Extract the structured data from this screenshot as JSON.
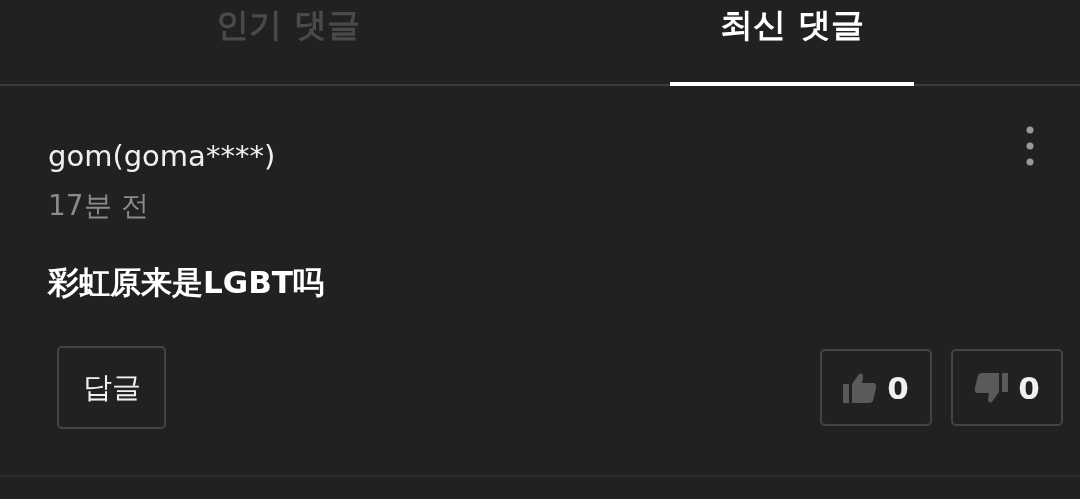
{
  "tabs": [
    {
      "label": "인기 댓글",
      "selected": false
    },
    {
      "label": "최신 댓글",
      "selected": true
    }
  ],
  "comment": {
    "author": "gom(goma****)",
    "time": "17분 전",
    "text": "彩虹原来是LGBT吗",
    "reply_button": "답글",
    "likes": "0",
    "dislikes": "0"
  }
}
